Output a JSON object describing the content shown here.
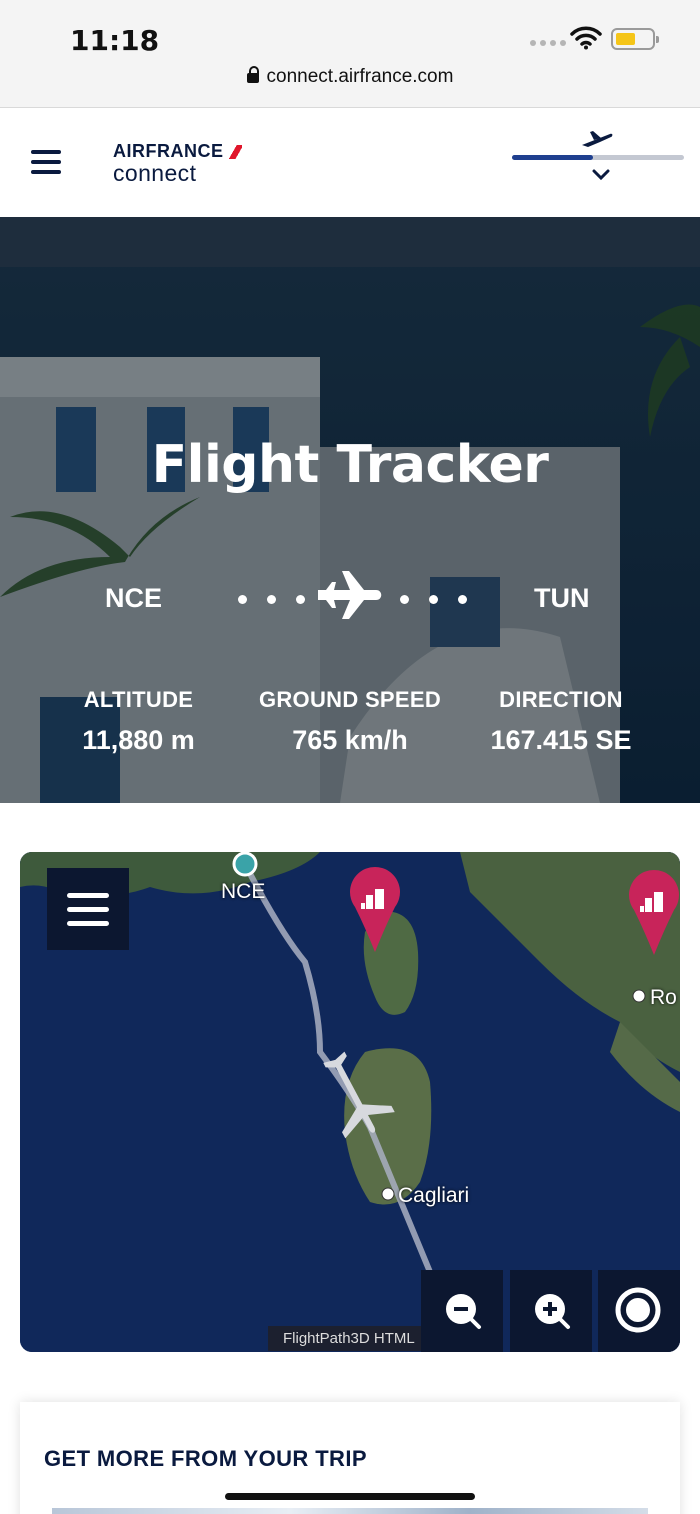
{
  "status_bar": {
    "time": "11:18",
    "url": "connect.airfrance.com"
  },
  "header": {
    "brand_top": "AIRFRANCE",
    "brand_bottom": "connect",
    "flight_progress": 0.47
  },
  "hero": {
    "title": "Flight Tracker",
    "origin": "NCE",
    "destination": "TUN",
    "stats": [
      {
        "label": "ALTITUDE",
        "value": "11,880 m"
      },
      {
        "label": "GROUND SPEED",
        "value": "765 km/h"
      },
      {
        "label": "DIRECTION",
        "value": "167.415 SE"
      }
    ]
  },
  "map": {
    "labels": {
      "origin": "NCE",
      "city_1": "Cagliari",
      "city_2": "Ro"
    },
    "credit": "FlightPath3D HTML",
    "icons": [
      "menu-icon",
      "zoom-out-icon",
      "zoom-in-icon",
      "center-icon",
      "city-pin-icon",
      "airplane-icon"
    ]
  },
  "card": {
    "title": "GET MORE FROM YOUR TRIP"
  },
  "colors": {
    "navy": "#0a1a3f",
    "brand_red": "#e0162b",
    "pin_magenta": "#c8245a",
    "progress": "#1f3f8f",
    "battery": "#f5c518"
  }
}
